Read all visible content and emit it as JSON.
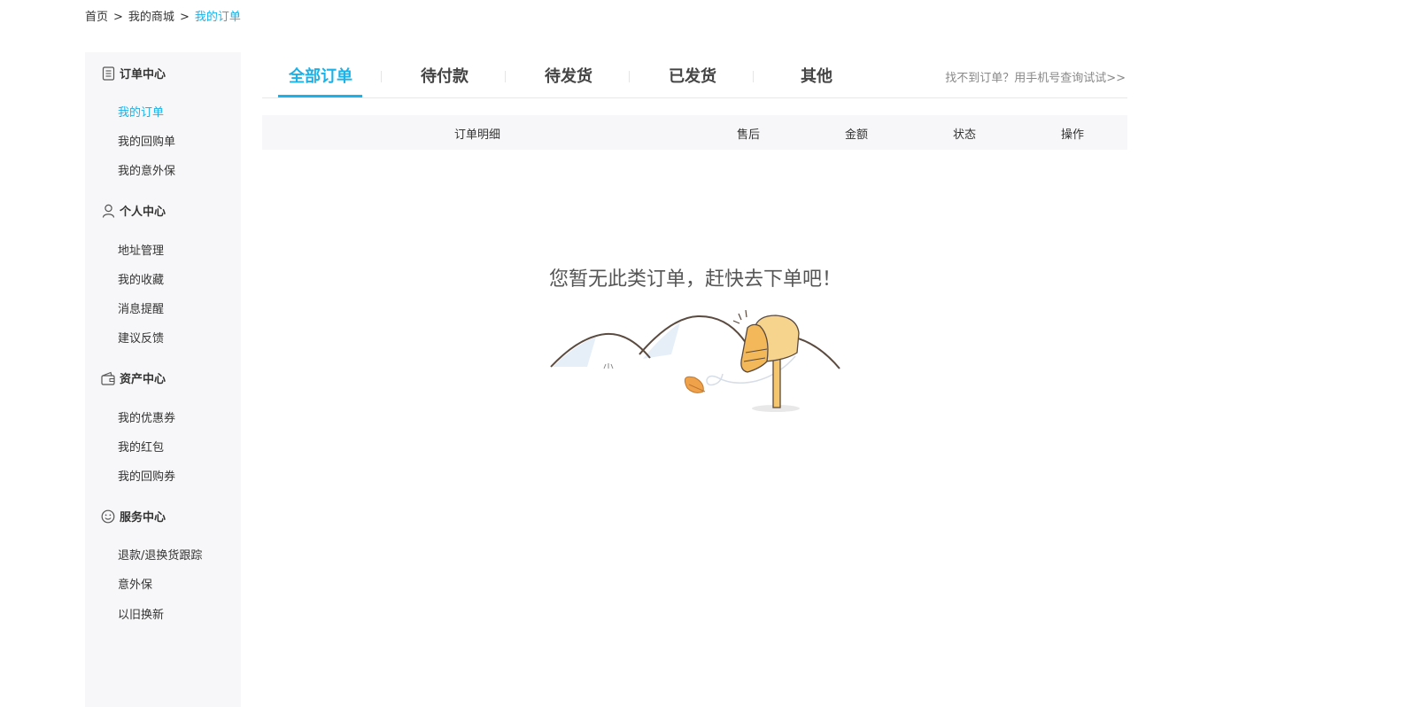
{
  "breadcrumb": {
    "home": "首页",
    "sep1": ">",
    "mall": "我的商城",
    "sep2": ">",
    "current": "我的订单"
  },
  "sidebar": {
    "sections": [
      {
        "title": "订单中心",
        "icon": "document-icon",
        "items": [
          "我的订单",
          "我的回购单",
          "我的意外保"
        ]
      },
      {
        "title": "个人中心",
        "icon": "user-icon",
        "items": [
          "地址管理",
          "我的收藏",
          "消息提醒",
          "建议反馈"
        ]
      },
      {
        "title": "资产中心",
        "icon": "wallet-icon",
        "items": [
          "我的优惠券",
          "我的红包",
          "我的回购券"
        ]
      },
      {
        "title": "服务中心",
        "icon": "smiley-icon",
        "items": [
          "退款/退换货跟踪",
          "意外保",
          "以旧换新"
        ]
      }
    ],
    "active_item": "我的订单"
  },
  "tabs": [
    "全部订单",
    "待付款",
    "待发货",
    "已发货",
    "其他"
  ],
  "active_tab": "全部订单",
  "help_link": "找不到订单？用手机号查询试试>>",
  "table_header": [
    "订单明细",
    "售后",
    "金额",
    "状态",
    "操作"
  ],
  "empty_message": "您暂无此类订单，赶快去下单吧！",
  "illustration": "mailbox-icon",
  "colors": {
    "accent": "#1ab2e8",
    "sidebar_bg": "#f7f7f9",
    "mailbox": "#f5c66e"
  }
}
